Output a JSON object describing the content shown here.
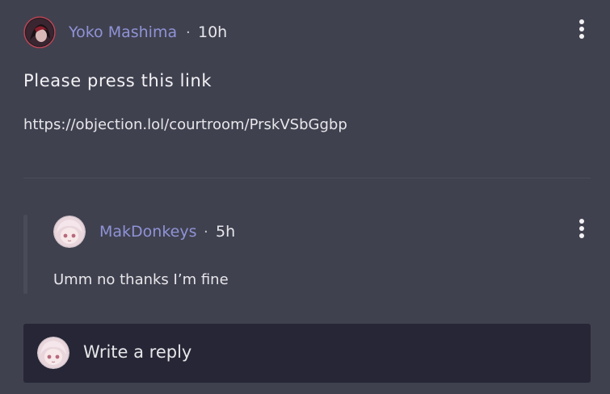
{
  "post": {
    "author": "Yoko Mashima",
    "separator": "·",
    "time": "10h",
    "title": "Please press this link",
    "link": "https://objection.lol/courtroom/PrskVSbGgbp"
  },
  "reply": {
    "author": "MakDonkeys",
    "separator": "·",
    "time": "5h",
    "text": "Umm no thanks I’m fine"
  },
  "composer": {
    "placeholder": "Write a reply"
  },
  "colors": {
    "background": "#40414f",
    "username": "#8f93d6",
    "reply_box": "#262636"
  },
  "icons": {
    "more": "kebab-vertical-icon"
  }
}
